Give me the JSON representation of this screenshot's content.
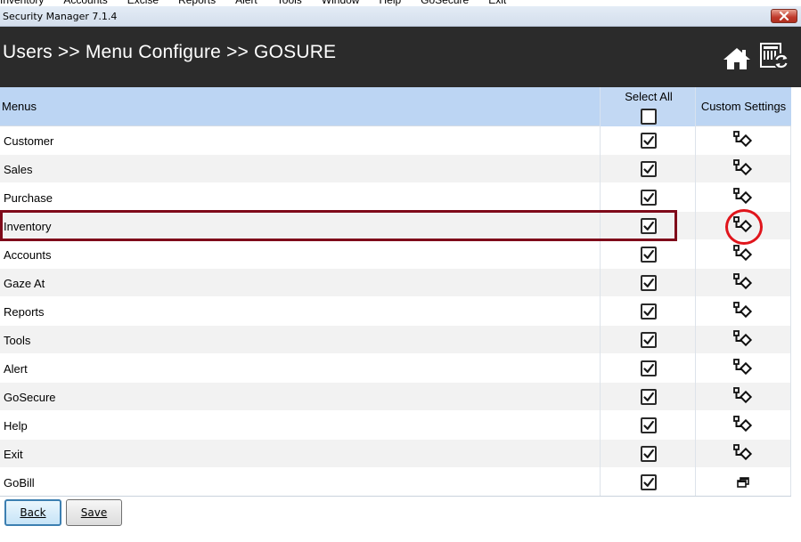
{
  "menubar": {
    "items": [
      "Inventory",
      "Accounts",
      "Excise",
      "Reports",
      "Alert",
      "Tools",
      "Window",
      "Help",
      "GoSecure",
      "Exit"
    ]
  },
  "window": {
    "title": "Security Manager 7.1.4"
  },
  "header": {
    "breadcrumb": "Users >> Menu Configure >> GOSURE",
    "background": "#2b2b2b"
  },
  "grid": {
    "columns": {
      "menus": "Menus",
      "select_all": "Select All",
      "custom_settings": "Custom Settings"
    },
    "header_color": "#bcd5f3",
    "select_all_checked": false,
    "rows": [
      {
        "name": "Customer",
        "checked": true,
        "icon": "custom-settings-icon"
      },
      {
        "name": "Sales",
        "checked": true,
        "icon": "custom-settings-icon"
      },
      {
        "name": "Purchase",
        "checked": true,
        "icon": "custom-settings-icon"
      },
      {
        "name": "Inventory",
        "checked": true,
        "icon": "custom-settings-icon",
        "highlighted": true
      },
      {
        "name": "Accounts",
        "checked": true,
        "icon": "custom-settings-icon"
      },
      {
        "name": "Gaze At",
        "checked": true,
        "icon": "custom-settings-icon"
      },
      {
        "name": "Reports",
        "checked": true,
        "icon": "custom-settings-icon"
      },
      {
        "name": "Tools",
        "checked": true,
        "icon": "custom-settings-icon"
      },
      {
        "name": "Alert",
        "checked": true,
        "icon": "custom-settings-icon"
      },
      {
        "name": "GoSecure",
        "checked": true,
        "icon": "custom-settings-icon"
      },
      {
        "name": "Help",
        "checked": true,
        "icon": "custom-settings-icon"
      },
      {
        "name": "Exit",
        "checked": true,
        "icon": "custom-settings-icon"
      },
      {
        "name": "GoBill",
        "checked": true,
        "icon": "window-restore-icon"
      }
    ]
  },
  "buttons": {
    "back": "Back",
    "save": "Save"
  },
  "annotation_colors": {
    "rect": "#7f0a1a",
    "circle": "#e0151c"
  }
}
